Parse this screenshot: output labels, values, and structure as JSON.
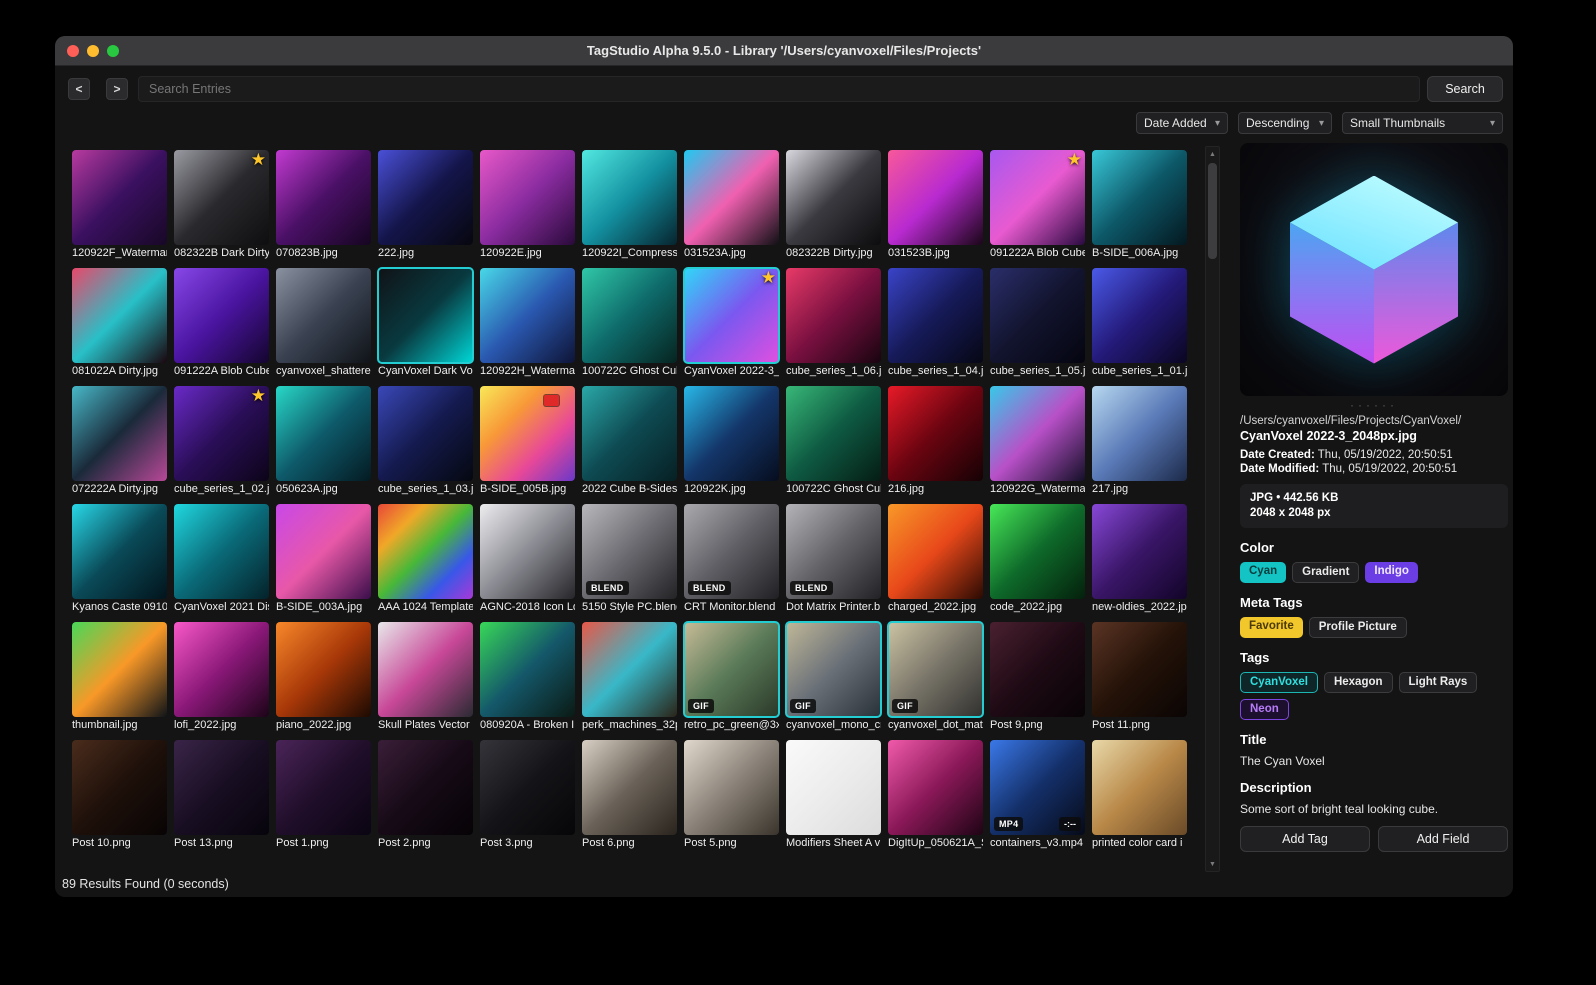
{
  "window": {
    "title": "TagStudio Alpha 9.5.0 - Library '/Users/cyanvoxel/Files/Projects'",
    "traffic_lights": [
      "#ff5f57",
      "#febc2e",
      "#28c840"
    ]
  },
  "icons": {
    "chevron_down": "▾",
    "star": "★",
    "scroll_up": "▲",
    "scroll_down": "▼",
    "back": "<",
    "forward": ">"
  },
  "colors": {
    "accent_cyan": "#23cdd2",
    "favorite_yellow": "#f2c72b",
    "indigo": "#6a3ee4",
    "titlebar": "#3b3b3d"
  },
  "toolbar": {
    "search_placeholder": "Search Entries",
    "search_button": "Search"
  },
  "filters": {
    "sort_field": "Date Added",
    "sort_order": "Descending",
    "thumb_size": "Small Thumbnails"
  },
  "status": "89 Results Found (0 seconds)",
  "grid": {
    "items": [
      {
        "caption": "120922F_Watermark",
        "colors": [
          "#b83aa0",
          "#3a1060",
          "#180826"
        ]
      },
      {
        "caption": "082322B Dark Dirty",
        "colors": [
          "#9a9aa2",
          "#2a2a2e",
          "#0e0e10"
        ],
        "corner": "star"
      },
      {
        "caption": "070823B.jpg",
        "colors": [
          "#c23ad0",
          "#4a1066",
          "#150520"
        ]
      },
      {
        "caption": "222.jpg",
        "colors": [
          "#4a50d8",
          "#14154a",
          "#07070f"
        ]
      },
      {
        "caption": "120922E.jpg",
        "colors": [
          "#e858c8",
          "#8a2ca0",
          "#2a0a3a"
        ]
      },
      {
        "caption": "120922I_Compress",
        "colors": [
          "#52e8e0",
          "#1390a0",
          "#06242e"
        ]
      },
      {
        "caption": "031523A.jpg",
        "colors": [
          "#20c8f0",
          "#f060b0",
          "#101014"
        ]
      },
      {
        "caption": "082322B Dirty.jpg",
        "colors": [
          "#d8d8de",
          "#3a3a40",
          "#0c0c0e"
        ]
      },
      {
        "caption": "031523B.jpg",
        "colors": [
          "#f8589a",
          "#b82ad0",
          "#1a0618"
        ]
      },
      {
        "caption": "091222A Blob Cube",
        "colors": [
          "#a858f0",
          "#e85ad0",
          "#2a0a40"
        ],
        "corner": "star"
      },
      {
        "caption": "B-SIDE_006A.jpg",
        "colors": [
          "#38c8d8",
          "#0d5868",
          "#041820"
        ]
      },
      {
        "caption": "081022A Dirty.jpg",
        "colors": [
          "#e8486a",
          "#28c0c8",
          "#1a060e"
        ]
      },
      {
        "caption": "091222A Blob Cube",
        "colors": [
          "#8848e8",
          "#4a14a0",
          "#14052e"
        ]
      },
      {
        "caption": "cyanvoxel_shattere",
        "colors": [
          "#8a92a2",
          "#3a4252",
          "#101418"
        ]
      },
      {
        "caption": "CyanVoxel Dark Vox",
        "colors": [
          "#101216",
          "#083a40",
          "#00d8d8"
        ],
        "selected": true
      },
      {
        "caption": "120922H_Waterma",
        "colors": [
          "#48d8e8",
          "#2a58b0",
          "#0e1436"
        ]
      },
      {
        "caption": "100722C Ghost Cub",
        "colors": [
          "#30c8a8",
          "#0e6a6a",
          "#062420"
        ]
      },
      {
        "caption": "CyanVoxel 2022-3_",
        "colors": [
          "#30d8f8",
          "#7a58f0",
          "#e050e0"
        ],
        "corner": "star",
        "selected": true
      },
      {
        "caption": "cube_series_1_06.j",
        "colors": [
          "#e83a68",
          "#7a1040",
          "#180410"
        ]
      },
      {
        "caption": "cube_series_1_04.j",
        "colors": [
          "#3a44c8",
          "#161a58",
          "#060714"
        ]
      },
      {
        "caption": "cube_series_1_05.j",
        "colors": [
          "#2a2e6a",
          "#12142e",
          "#050510"
        ]
      },
      {
        "caption": "cube_series_1_01.j",
        "colors": [
          "#4a5ae8",
          "#241a7a",
          "#0a0620"
        ]
      },
      {
        "caption": "072222A Dirty.jpg",
        "colors": [
          "#48b8c8",
          "#1a2a3a",
          "#b84898"
        ]
      },
      {
        "caption": "cube_series_1_02.j",
        "colors": [
          "#6a2ac8",
          "#2a0e58",
          "#0c0418"
        ],
        "corner": "star"
      },
      {
        "caption": "050623A.jpg",
        "colors": [
          "#28d8c8",
          "#0e5a6a",
          "#041a22"
        ]
      },
      {
        "caption": "cube_series_1_03.j",
        "colors": [
          "#3a48b8",
          "#141a4e",
          "#050810"
        ]
      },
      {
        "caption": "B-SIDE_005B.jpg",
        "colors": [
          "#f8e858",
          "#f89838",
          "#e84898",
          "#6a38c8"
        ],
        "corner": "chip"
      },
      {
        "caption": "2022 Cube B-Sides",
        "colors": [
          "#2aa8a8",
          "#0e4a52",
          "#062024"
        ]
      },
      {
        "caption": "120922K.jpg",
        "colors": [
          "#28b8e8",
          "#14366a",
          "#060d1e"
        ]
      },
      {
        "caption": "100722C Ghost Cub",
        "colors": [
          "#38b878",
          "#0e5a42",
          "#051c14"
        ]
      },
      {
        "caption": "216.jpg",
        "colors": [
          "#e81a28",
          "#6a0410",
          "#150204"
        ]
      },
      {
        "caption": "120922G_Waterma",
        "colors": [
          "#38c8e8",
          "#b850c8",
          "#141028"
        ]
      },
      {
        "caption": "217.jpg",
        "colors": [
          "#b8d8f0",
          "#5a7ab8",
          "#1c2a4a"
        ]
      },
      {
        "caption": "Kyanos Caste 0910",
        "colors": [
          "#28d8e8",
          "#0a4a58",
          "#02141c"
        ]
      },
      {
        "caption": "CyanVoxel 2021 Dis",
        "colors": [
          "#20d8e0",
          "#0a6a78",
          "#04222a"
        ]
      },
      {
        "caption": "B-SIDE_003A.jpg",
        "colors": [
          "#c848e8",
          "#e858a8",
          "#3a0e4a"
        ]
      },
      {
        "caption": "AAA 1024 Template",
        "colors": [
          "#e84838",
          "#f0a828",
          "#48b838",
          "#3858e8",
          "#a838d8"
        ]
      },
      {
        "caption": "AGNC-2018 Icon Lo",
        "colors": [
          "#ededf0",
          "#8a8a92",
          "#26262a"
        ]
      },
      {
        "caption": "5150 Style PC.blend",
        "colors": [
          "#b8b8bc",
          "#6a6a70",
          "#232326"
        ],
        "badge": "BLEND"
      },
      {
        "caption": "CRT Monitor.blend",
        "colors": [
          "#aaaaae",
          "#5e5e64",
          "#202024"
        ],
        "badge": "BLEND"
      },
      {
        "caption": "Dot Matrix Printer.b",
        "colors": [
          "#b4b4b8",
          "#646468",
          "#222226"
        ],
        "badge": "BLEND"
      },
      {
        "caption": "charged_2022.jpg",
        "colors": [
          "#f89828",
          "#e8481a",
          "#2a0a02"
        ]
      },
      {
        "caption": "code_2022.jpg",
        "colors": [
          "#48e858",
          "#0e6a2a",
          "#04200c"
        ]
      },
      {
        "caption": "new-oldies_2022.jp",
        "colors": [
          "#8848d8",
          "#3a1668",
          "#120428"
        ]
      },
      {
        "caption": "thumbnail.jpg",
        "colors": [
          "#48d858",
          "#f89828",
          "#101418"
        ]
      },
      {
        "caption": "lofi_2022.jpg",
        "colors": [
          "#f858c8",
          "#8a1878",
          "#1c0418"
        ]
      },
      {
        "caption": "piano_2022.jpg",
        "colors": [
          "#f8882a",
          "#a83808",
          "#1c0a02"
        ]
      },
      {
        "caption": "Skull Plates Vector",
        "colors": [
          "#e8e8ea",
          "#c84898",
          "#2a2a32"
        ]
      },
      {
        "caption": "080920A - Broken I",
        "colors": [
          "#38d858",
          "#14586a",
          "#0a1a14"
        ]
      },
      {
        "caption": "perk_machines_32p",
        "colors": [
          "#e85848",
          "#38b8c8",
          "#2a2418"
        ]
      },
      {
        "caption": "retro_pc_green@3x",
        "colors": [
          "#c8bc98",
          "#5a7a58",
          "#2a3828"
        ],
        "badge": "GIF",
        "selected": true
      },
      {
        "caption": "cyanvoxel_mono_cr",
        "colors": [
          "#c0b898",
          "#6a7078",
          "#283038"
        ],
        "badge": "GIF",
        "selected": true
      },
      {
        "caption": "cyanvoxel_dot_mat",
        "colors": [
          "#ccc4a4",
          "#787468",
          "#30302e"
        ],
        "badge": "GIF",
        "selected": true
      },
      {
        "caption": "Post 9.png",
        "colors": [
          "#4a2030",
          "#1e0a14",
          "#080306"
        ]
      },
      {
        "caption": "Post 11.png",
        "colors": [
          "#5a3424",
          "#241208",
          "#0a0504"
        ]
      },
      {
        "caption": "Post 10.png",
        "colors": [
          "#4a2c1c",
          "#1e100a",
          "#080404"
        ]
      },
      {
        "caption": "Post 13.png",
        "colors": [
          "#3a2448",
          "#180e22",
          "#07040c"
        ]
      },
      {
        "caption": "Post 1.png",
        "colors": [
          "#4a2458",
          "#200e2a",
          "#0a0512"
        ]
      },
      {
        "caption": "Post 2.png",
        "colors": [
          "#3a1e38",
          "#160a16",
          "#060306"
        ]
      },
      {
        "caption": "Post 3.png",
        "colors": [
          "#34343a",
          "#141418",
          "#060608"
        ]
      },
      {
        "caption": "Post 6.png",
        "colors": [
          "#d8d0c4",
          "#6a6258",
          "#2a241e"
        ]
      },
      {
        "caption": "Post 5.png",
        "colors": [
          "#e0d8cc",
          "#8a8278",
          "#3a342c"
        ]
      },
      {
        "caption": "Modifiers Sheet A v",
        "colors": [
          "#fafafa",
          "#ececec",
          "#dcdcdc"
        ]
      },
      {
        "caption": "DigItUp_050621A_S",
        "colors": [
          "#f05aaa",
          "#8a1858",
          "#1e0414"
        ]
      },
      {
        "caption": "containers_v3.mp4",
        "colors": [
          "#3a78e8",
          "#14306a",
          "#060a18"
        ],
        "badge": "MP4",
        "time": "-:--"
      },
      {
        "caption": "printed color card i",
        "colors": [
          "#e8d8a8",
          "#b88848",
          "#6a4a28"
        ]
      }
    ]
  },
  "preview": {
    "path": "/Users/cyanvoxel/Files/Projects/CyanVoxel/",
    "filename": "CyanVoxel 2022-3_2048px.jpg",
    "date_created_label": "Date Created:",
    "date_created_value": " Thu, 05/19/2022, 20:50:51",
    "date_modified_label": "Date Modified:",
    "date_modified_value": " Thu, 05/19/2022, 20:50:51",
    "file_info_line1": "JPG  •  442.56 KB",
    "file_info_line2": "2048 x 2048 px",
    "fields": [
      {
        "heading": "Color",
        "pills": [
          {
            "label": "Cyan",
            "style": "cyan"
          },
          {
            "label": "Gradient",
            "style": "plain"
          },
          {
            "label": "Indigo",
            "style": "indigo"
          }
        ]
      },
      {
        "heading": "Meta Tags",
        "pills": [
          {
            "label": "Favorite",
            "style": "yellow"
          },
          {
            "label": "Profile Picture",
            "style": "plain"
          }
        ]
      },
      {
        "heading": "Tags",
        "pills": [
          {
            "label": "CyanVoxel",
            "style": "cyan-outline"
          },
          {
            "label": "Hexagon",
            "style": "plain"
          },
          {
            "label": "Light Rays",
            "style": "plain"
          },
          {
            "label": "Neon",
            "style": "purple-outline"
          }
        ]
      },
      {
        "heading": "Title",
        "text": "The Cyan Voxel"
      },
      {
        "heading": "Description",
        "text": "Some sort of bright teal looking cube."
      }
    ],
    "add_tag_button": "Add Tag",
    "add_field_button": "Add Field",
    "resize_dots": "······"
  }
}
